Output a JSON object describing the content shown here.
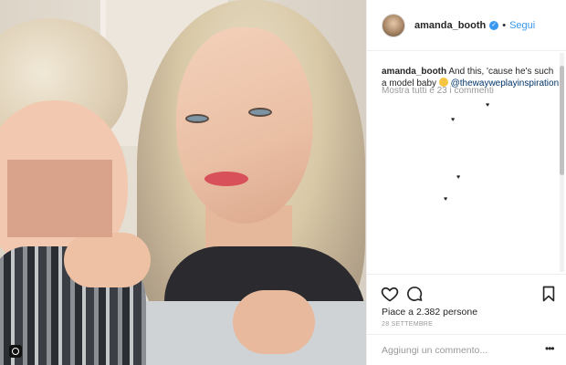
{
  "post": {
    "username": "amanda_booth",
    "verified": true,
    "separator": "•",
    "follow_label": "Segui",
    "caption": {
      "username": "amanda_booth",
      "text": "And this, 'cause he's such a model baby",
      "emoji": "grinning-face-emoji",
      "mention": "@thewayweplayinspiration"
    },
    "view_comments_label": "Mostra tutti e 23 i commenti",
    "likes_label": "Piace a 2.382 persone",
    "date_label": "28 SETTEMBRE",
    "comment_placeholder": "Aggiungi un commento...",
    "more_label": "•••"
  },
  "icons": {
    "like": "heart-icon",
    "comment": "comment-bubble-icon",
    "save": "bookmark-icon",
    "more": "more-options-icon",
    "verified": "verified-badge-icon",
    "photo_badge": "instagram-icon"
  },
  "colors": {
    "link_blue": "#3897f0",
    "mention_blue": "#003569",
    "muted_gray": "#999999",
    "text": "#262626",
    "divider": "#efefef"
  }
}
